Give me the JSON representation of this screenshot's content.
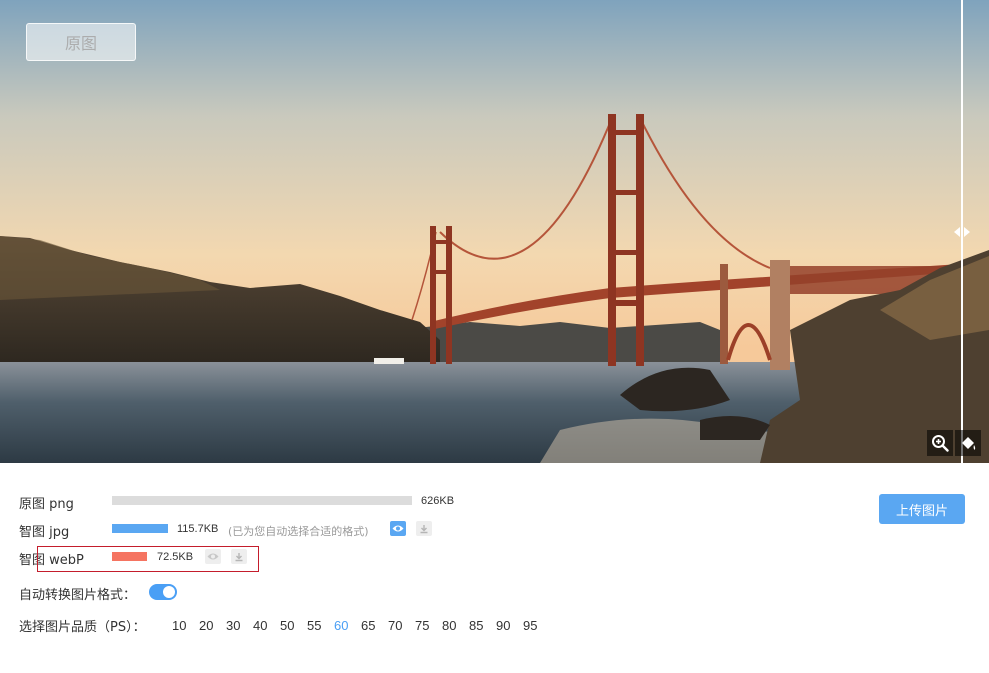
{
  "viewer": {
    "original_button": "原图",
    "tools": {
      "zoom": "zoom-in-icon",
      "background": "paint-bucket-icon"
    }
  },
  "rows": {
    "original": {
      "label": "原图 png",
      "size": "626KB",
      "bar_fraction": 1.0,
      "bar_color": "#dcdcdc"
    },
    "jpg": {
      "label": "智图 jpg",
      "size": "115.7KB",
      "note": "(已为您自动选择合适的格式)",
      "bar_fraction": 0.185,
      "bar_color": "#5aa7f2"
    },
    "webp": {
      "label": "智图 webP",
      "size": "72.5KB",
      "bar_fraction": 0.116,
      "bar_color": "#f57461"
    }
  },
  "upload_button": "上传图片",
  "auto_convert": {
    "label": "自动转换图片格式：",
    "enabled": true
  },
  "quality": {
    "label": "选择图片品质（PS）：",
    "options": [
      "10",
      "20",
      "30",
      "40",
      "50",
      "55",
      "60",
      "65",
      "70",
      "75",
      "80",
      "85",
      "90",
      "95"
    ],
    "selected": "60"
  },
  "colors": {
    "accent": "#4a9ff5",
    "highlight": "#c41d2c"
  }
}
